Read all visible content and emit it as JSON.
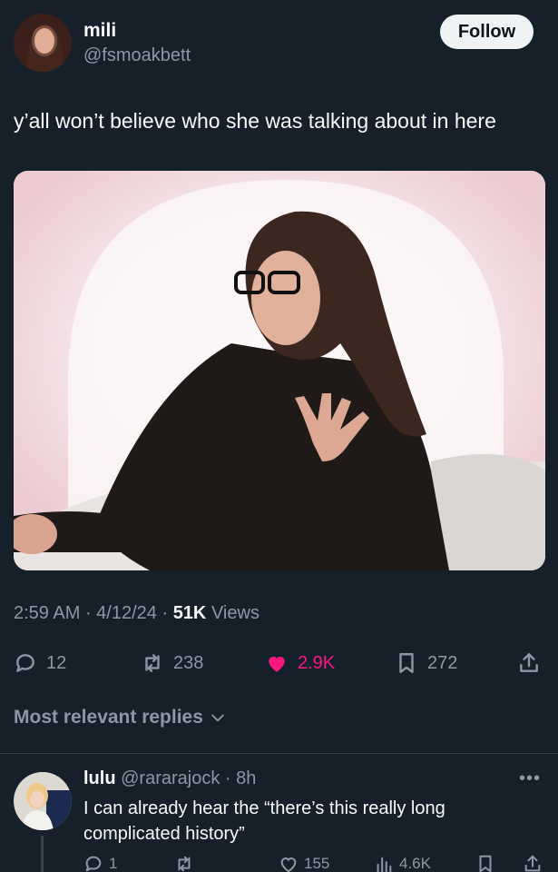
{
  "author": {
    "name": "mili",
    "handle": "@fsmoakbett",
    "follow_label": "Follow"
  },
  "tweet": {
    "text": "y’all won’t believe who she was talking about in here",
    "time": "2:59 AM",
    "date": "4/12/24",
    "views_count": "51K",
    "views_label": "Views"
  },
  "actions": {
    "replies": "12",
    "reposts": "238",
    "likes": "2.9K",
    "bookmarks": "272"
  },
  "colors": {
    "background": "#15202b",
    "like": "#f91880",
    "muted": "#8b98a5"
  },
  "replies_filter": {
    "label": "Most relevant replies"
  },
  "reply": {
    "name": "lulu",
    "handle": "@rararajock",
    "time": "8h",
    "text": "I can already hear the “there’s this really long complicated history”",
    "replies": "1",
    "likes": "155",
    "views": "4.6K"
  }
}
